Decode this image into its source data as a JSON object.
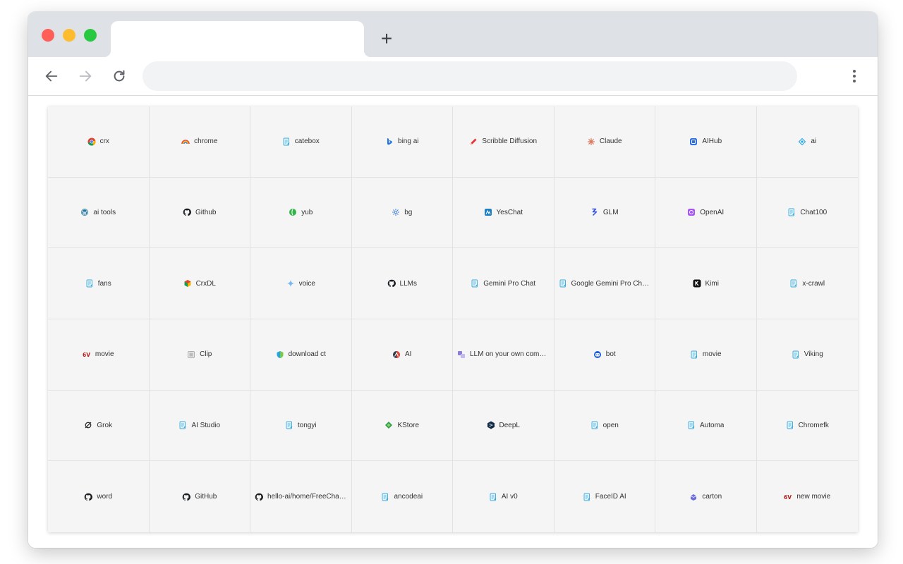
{
  "browser": {
    "tab_title": "",
    "new_tab_label": "+",
    "address_value": "",
    "address_placeholder": ""
  },
  "colors": {
    "grid_background": "#f5f5f5",
    "grid_border": "#e2e2e2",
    "tabbar": "#dee1e6"
  },
  "shortcuts": [
    {
      "label": "crx",
      "icon": "chrome-icon"
    },
    {
      "label": "chrome",
      "icon": "chrome-rainbow-icon"
    },
    {
      "label": "catebox",
      "icon": "doc-icon"
    },
    {
      "label": "bing ai",
      "icon": "bing-icon"
    },
    {
      "label": "Scribble Diffusion",
      "icon": "pencil-icon"
    },
    {
      "label": "Claude",
      "icon": "claude-icon"
    },
    {
      "label": "AIHub",
      "icon": "aihub-icon"
    },
    {
      "label": "ai",
      "icon": "diamond-icon"
    },
    {
      "label": "ai tools",
      "icon": "wordpress-icon"
    },
    {
      "label": "Github",
      "icon": "github-icon"
    },
    {
      "label": "yub",
      "icon": "leaf-icon"
    },
    {
      "label": "bg",
      "icon": "gear-icon"
    },
    {
      "label": "YesChat",
      "icon": "yeschat-icon"
    },
    {
      "label": "GLM",
      "icon": "glm-icon"
    },
    {
      "label": "OpenAI",
      "icon": "openai-icon"
    },
    {
      "label": "Chat100",
      "icon": "doc-icon"
    },
    {
      "label": "fans",
      "icon": "doc-icon"
    },
    {
      "label": "CrxDL",
      "icon": "crxdl-icon"
    },
    {
      "label": "voice",
      "icon": "sparkle-icon"
    },
    {
      "label": "LLMs",
      "icon": "github-icon"
    },
    {
      "label": "Gemini Pro Chat",
      "icon": "doc-icon"
    },
    {
      "label": "Google Gemini Pro Chat Bot",
      "icon": "doc-icon"
    },
    {
      "label": "Kimi",
      "icon": "kimi-icon"
    },
    {
      "label": "x-crawl",
      "icon": "doc-icon"
    },
    {
      "label": "movie",
      "icon": "6v-icon"
    },
    {
      "label": "Clip",
      "icon": "clip-icon"
    },
    {
      "label": "download ct",
      "icon": "shield-icon"
    },
    {
      "label": "AI",
      "icon": "ai-circle-icon"
    },
    {
      "label": "LLM on your own computer",
      "icon": "llm-icon"
    },
    {
      "label": "bot",
      "icon": "bot-icon"
    },
    {
      "label": "movie",
      "icon": "doc-icon"
    },
    {
      "label": "Viking",
      "icon": "doc-icon"
    },
    {
      "label": "Grok",
      "icon": "grok-icon"
    },
    {
      "label": "AI Studio",
      "icon": "doc-icon"
    },
    {
      "label": "tongyi",
      "icon": "doc-icon"
    },
    {
      "label": "KStore",
      "icon": "kstore-icon"
    },
    {
      "label": "DeepL",
      "icon": "deepl-icon"
    },
    {
      "label": "open",
      "icon": "doc-icon"
    },
    {
      "label": "Automa",
      "icon": "doc-icon"
    },
    {
      "label": "Chromefk",
      "icon": "doc-icon"
    },
    {
      "label": "word",
      "icon": "github-icon"
    },
    {
      "label": "GitHub",
      "icon": "github-icon"
    },
    {
      "label": "hello-ai/home/FreeChatGPT",
      "icon": "github-icon"
    },
    {
      "label": "ancodeai",
      "icon": "doc-icon"
    },
    {
      "label": "AI v0",
      "icon": "doc-icon"
    },
    {
      "label": "FaceID AI",
      "icon": "doc-icon"
    },
    {
      "label": "carton",
      "icon": "carton-icon"
    },
    {
      "label": "new movie",
      "icon": "6v-icon"
    }
  ]
}
